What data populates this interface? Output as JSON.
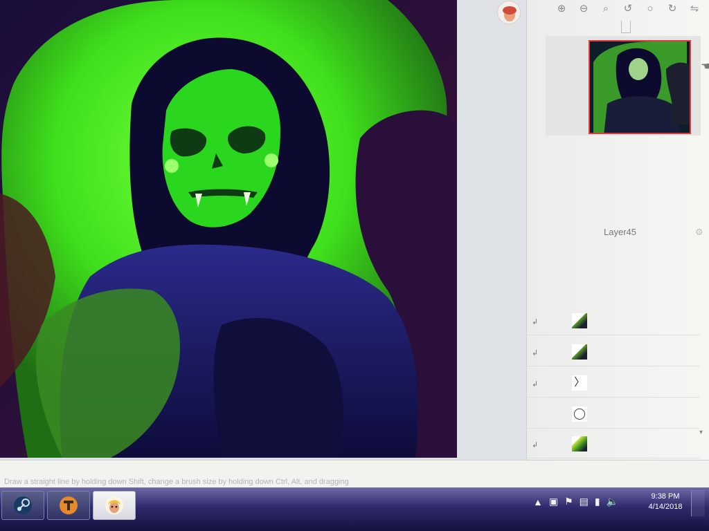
{
  "status_bar": {
    "hint": "Draw a straight line by holding down Shift, change a brush size by holding down Ctrl, Alt, and dragging"
  },
  "layers_panel": {
    "current_layer": "Layer45"
  },
  "taskbar": {
    "apps": [
      "steam-app",
      "tf2-app",
      "painting-app"
    ],
    "clock_time": "9:38 PM",
    "clock_date": "4/14/2018"
  },
  "icons": {
    "zoom_in": "zoom-in-icon",
    "zoom_out": "zoom-out-icon",
    "zoom_fit": "zoom-fit-icon",
    "rotate_left": "rotate-left-icon",
    "reset": "reset-icon",
    "rotate_right": "rotate-right-icon",
    "flip": "flip-icon",
    "settings": "gear-icon"
  },
  "colors": {
    "glow_green": "#3fe01c",
    "skull_green": "#2bd61e",
    "hood_dark": "#0c0a2e",
    "cloak_navy": "#1a1858",
    "cloak_green": "#3a8a22",
    "background_shadow": "#5a1a2a",
    "taskbar": "#2f2a6b",
    "nav_highlight": "#e23b3b"
  }
}
